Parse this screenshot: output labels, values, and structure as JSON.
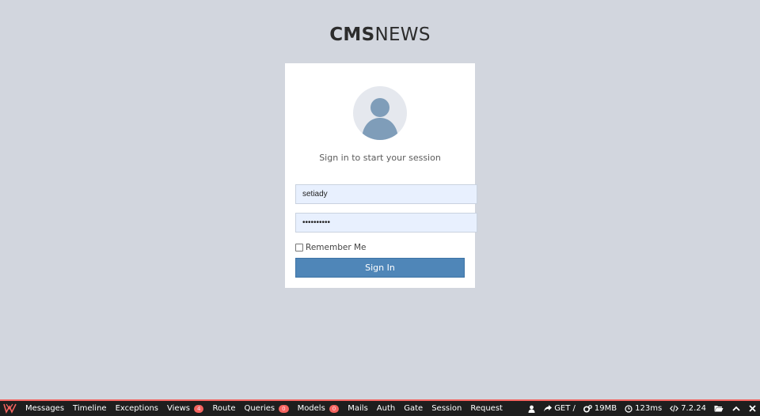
{
  "logo": {
    "bold": "CMS",
    "light": "NEWS"
  },
  "login": {
    "subtitle": "Sign in to start your session",
    "username_value": "setiady",
    "password_value": "••••••••••",
    "remember_label": "Remember Me",
    "remember_checked": false,
    "submit_label": "Sign In"
  },
  "debugbar": {
    "tabs": [
      {
        "label": "Messages"
      },
      {
        "label": "Timeline"
      },
      {
        "label": "Exceptions"
      },
      {
        "label": "Views",
        "badge": "4"
      },
      {
        "label": "Route"
      },
      {
        "label": "Queries",
        "badge": "0"
      },
      {
        "label": "Models",
        "badge": "0"
      },
      {
        "label": "Mails"
      },
      {
        "label": "Auth"
      },
      {
        "label": "Gate"
      },
      {
        "label": "Session"
      },
      {
        "label": "Request"
      }
    ],
    "request": "GET /",
    "memory": "19MB",
    "time": "123ms",
    "php_version": "7.2.24",
    "icons": [
      "user-icon",
      "share-icon",
      "cogs-icon",
      "clock-icon",
      "code-icon",
      "folder-open-icon",
      "chevron-up-icon",
      "close-icon"
    ],
    "accent_color": "#f4645f"
  }
}
